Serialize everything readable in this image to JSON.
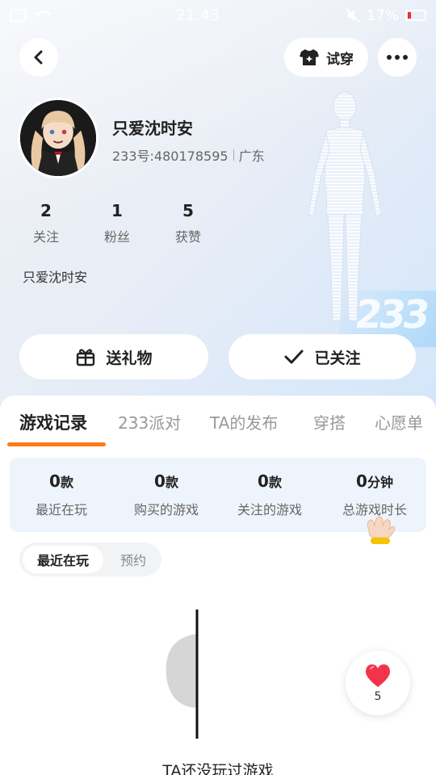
{
  "status_bar": {
    "time": "21:43",
    "battery": "17%"
  },
  "header": {
    "try_on_label": "试穿"
  },
  "profile": {
    "nickname": "只爱沈时安",
    "account_id": "233号:480178595",
    "region": "广东",
    "bio": "只爱沈时安"
  },
  "stats": [
    {
      "value": "2",
      "label": "关注"
    },
    {
      "value": "1",
      "label": "粉丝"
    },
    {
      "value": "5",
      "label": "获赞"
    }
  ],
  "actions": {
    "gift_label": "送礼物",
    "follow_label": "已关注"
  },
  "tabs": [
    {
      "label": "游戏记录"
    },
    {
      "label": "233派对"
    },
    {
      "label": "TA的发布"
    },
    {
      "label": "穿搭"
    },
    {
      "label": "心愿单"
    }
  ],
  "game_stats": [
    {
      "value": "0",
      "unit": "款",
      "label": "最近在玩"
    },
    {
      "value": "0",
      "unit": "款",
      "label": "购买的游戏"
    },
    {
      "value": "0",
      "unit": "款",
      "label": "关注的游戏"
    },
    {
      "value": "0",
      "unit": "分钟",
      "label": "总游戏时长"
    }
  ],
  "segment": {
    "items": [
      {
        "label": "最近在玩"
      },
      {
        "label": "预约"
      }
    ]
  },
  "empty_state": {
    "text": "TA还没玩过游戏"
  },
  "like": {
    "count": "5"
  },
  "decor": {
    "bg_text": "233"
  },
  "colors": {
    "accent": "#ff7a1a",
    "heart": "#f2344a",
    "battery_low": "#e5322d"
  }
}
